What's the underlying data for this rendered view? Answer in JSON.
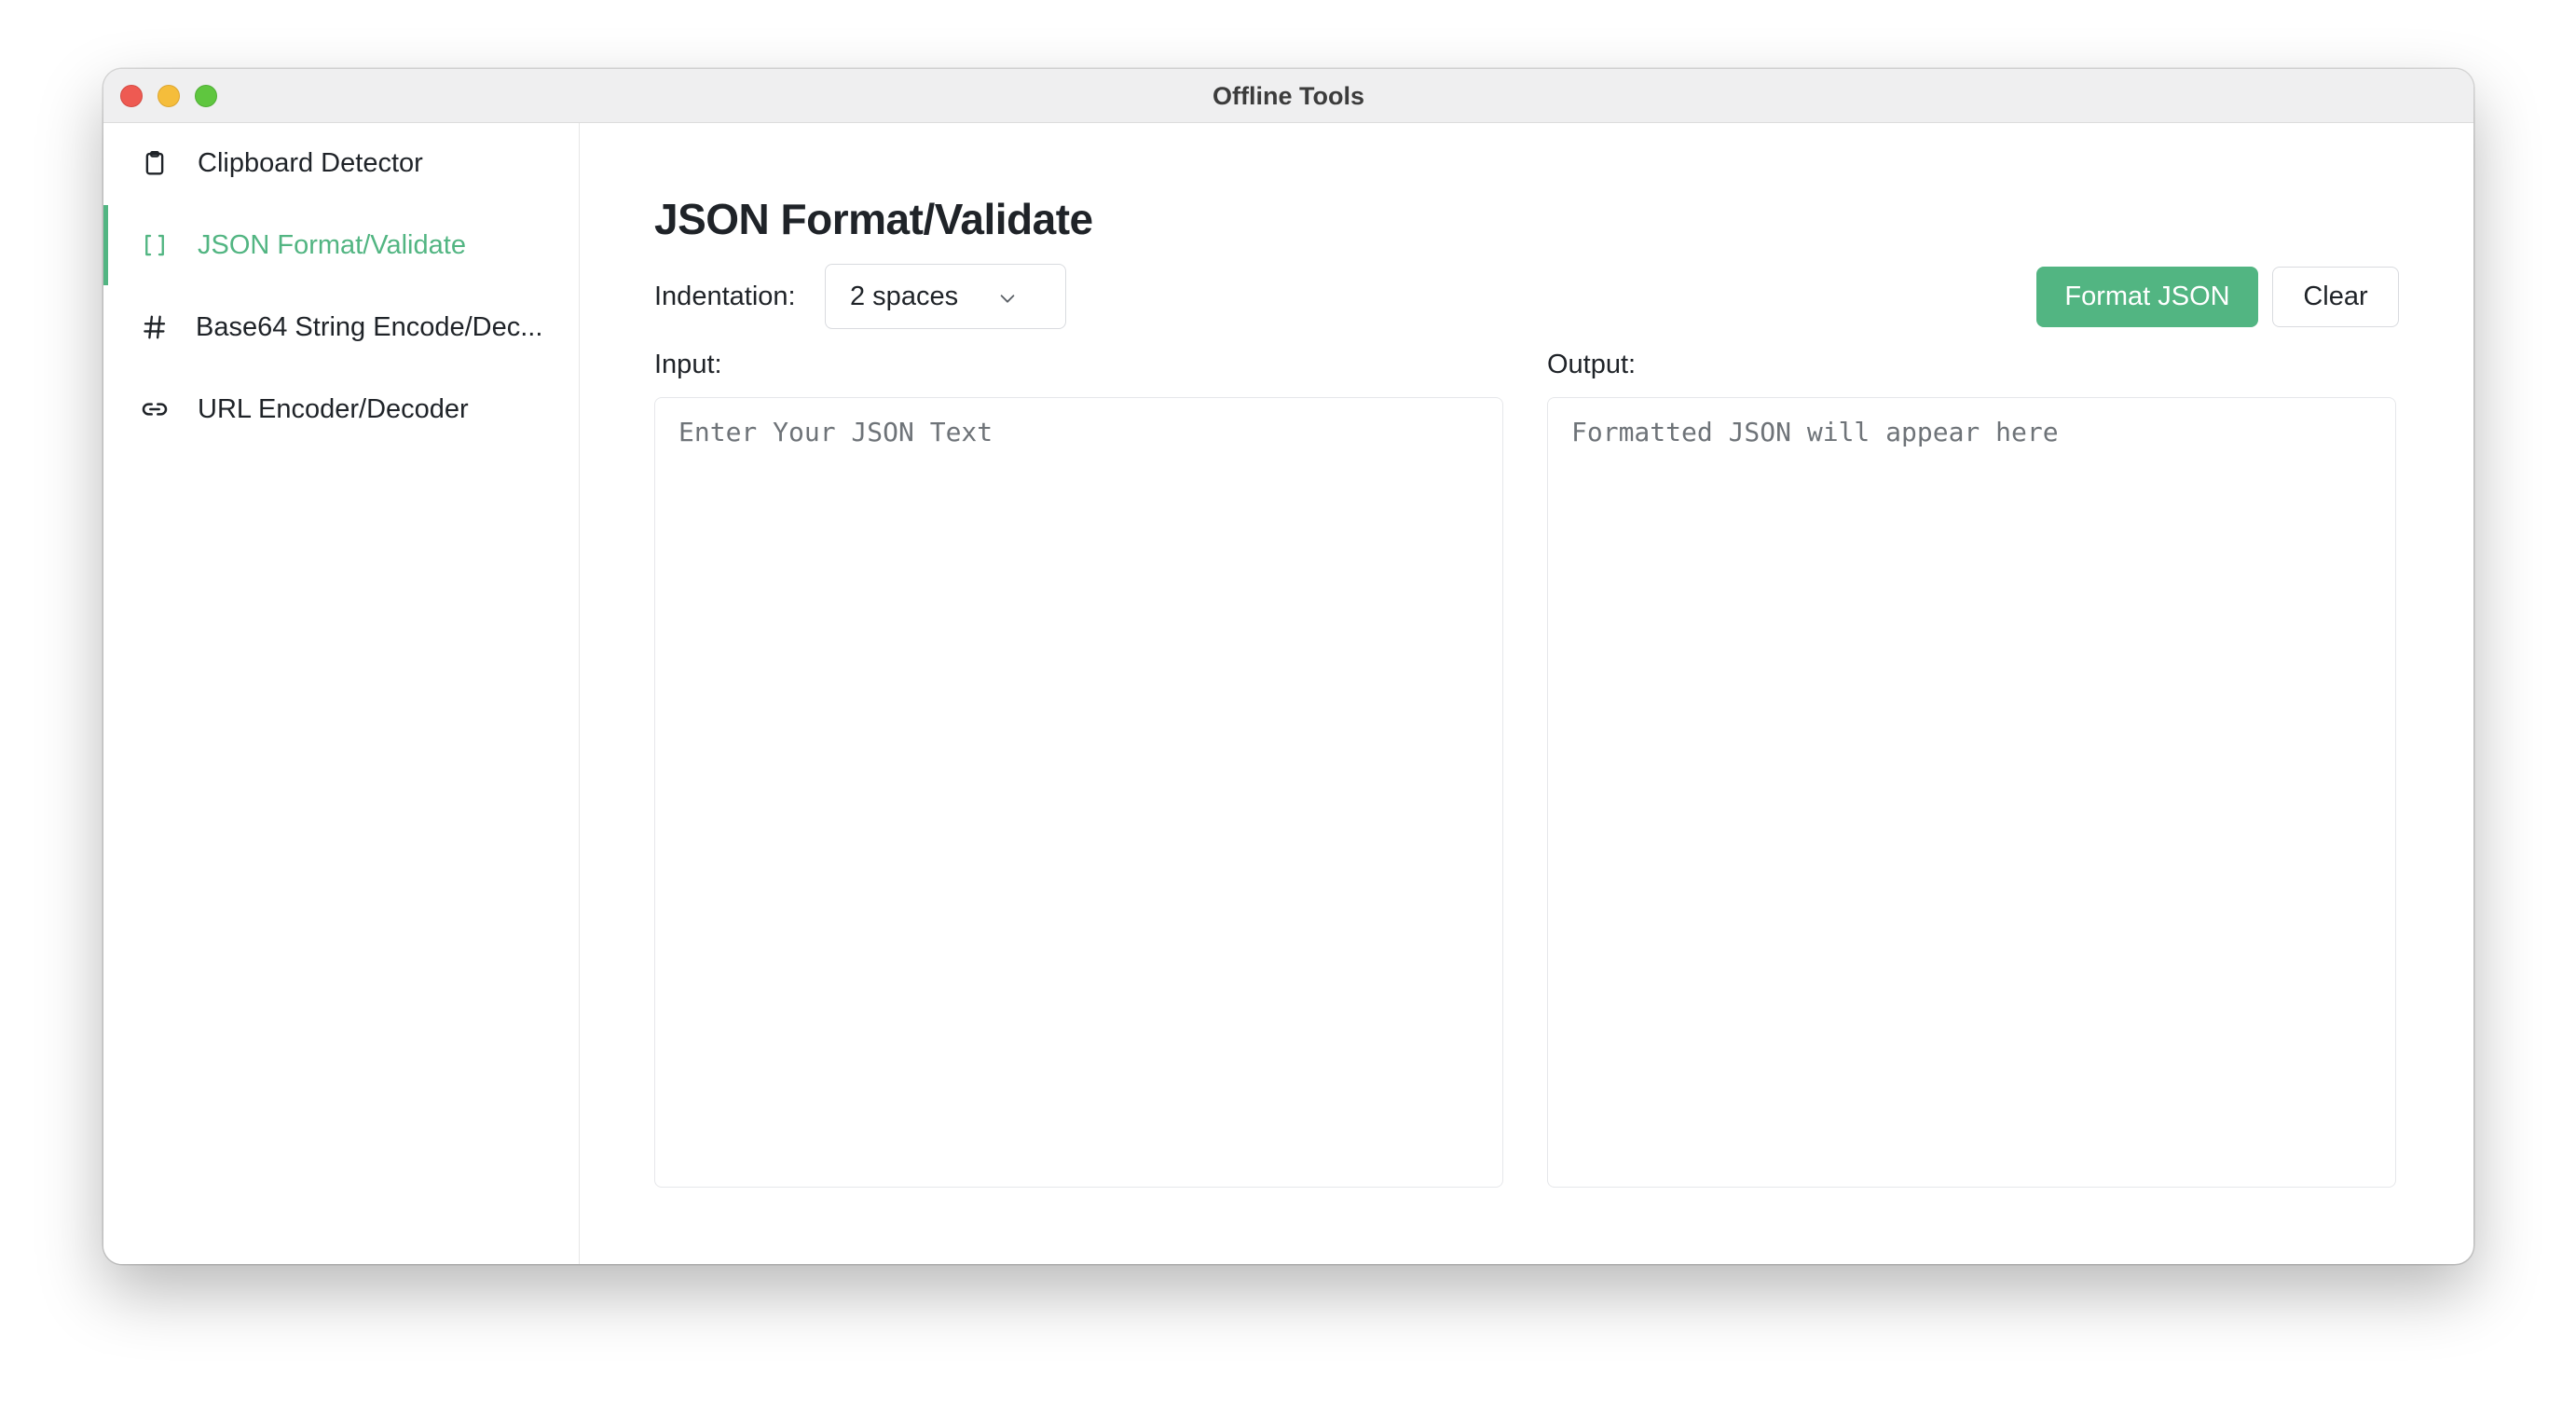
{
  "window": {
    "title": "Offline Tools"
  },
  "sidebar": {
    "items": [
      {
        "label": "Clipboard Detector",
        "icon": "clipboard-icon",
        "active": false
      },
      {
        "label": "JSON Format/Validate",
        "icon": "brackets-icon",
        "active": true
      },
      {
        "label": "Base64 String Encode/Dec...",
        "icon": "hash-icon",
        "active": false
      },
      {
        "label": "URL Encoder/Decoder",
        "icon": "link-icon",
        "active": false
      }
    ]
  },
  "main": {
    "title": "JSON Format/Validate",
    "indentation": {
      "label": "Indentation:",
      "value": "2 spaces"
    },
    "buttons": {
      "format": "Format JSON",
      "clear": "Clear"
    },
    "input": {
      "label": "Input:",
      "placeholder": "Enter Your JSON Text",
      "value": ""
    },
    "output": {
      "label": "Output:",
      "placeholder": "Formatted JSON will appear here",
      "value": ""
    }
  },
  "colors": {
    "accent": "#52b582",
    "text": "#1f2328",
    "titlebar": "#efeff0",
    "close": "#ee5a52",
    "minimize": "#f5bd3b",
    "maximize": "#5fc63f"
  }
}
